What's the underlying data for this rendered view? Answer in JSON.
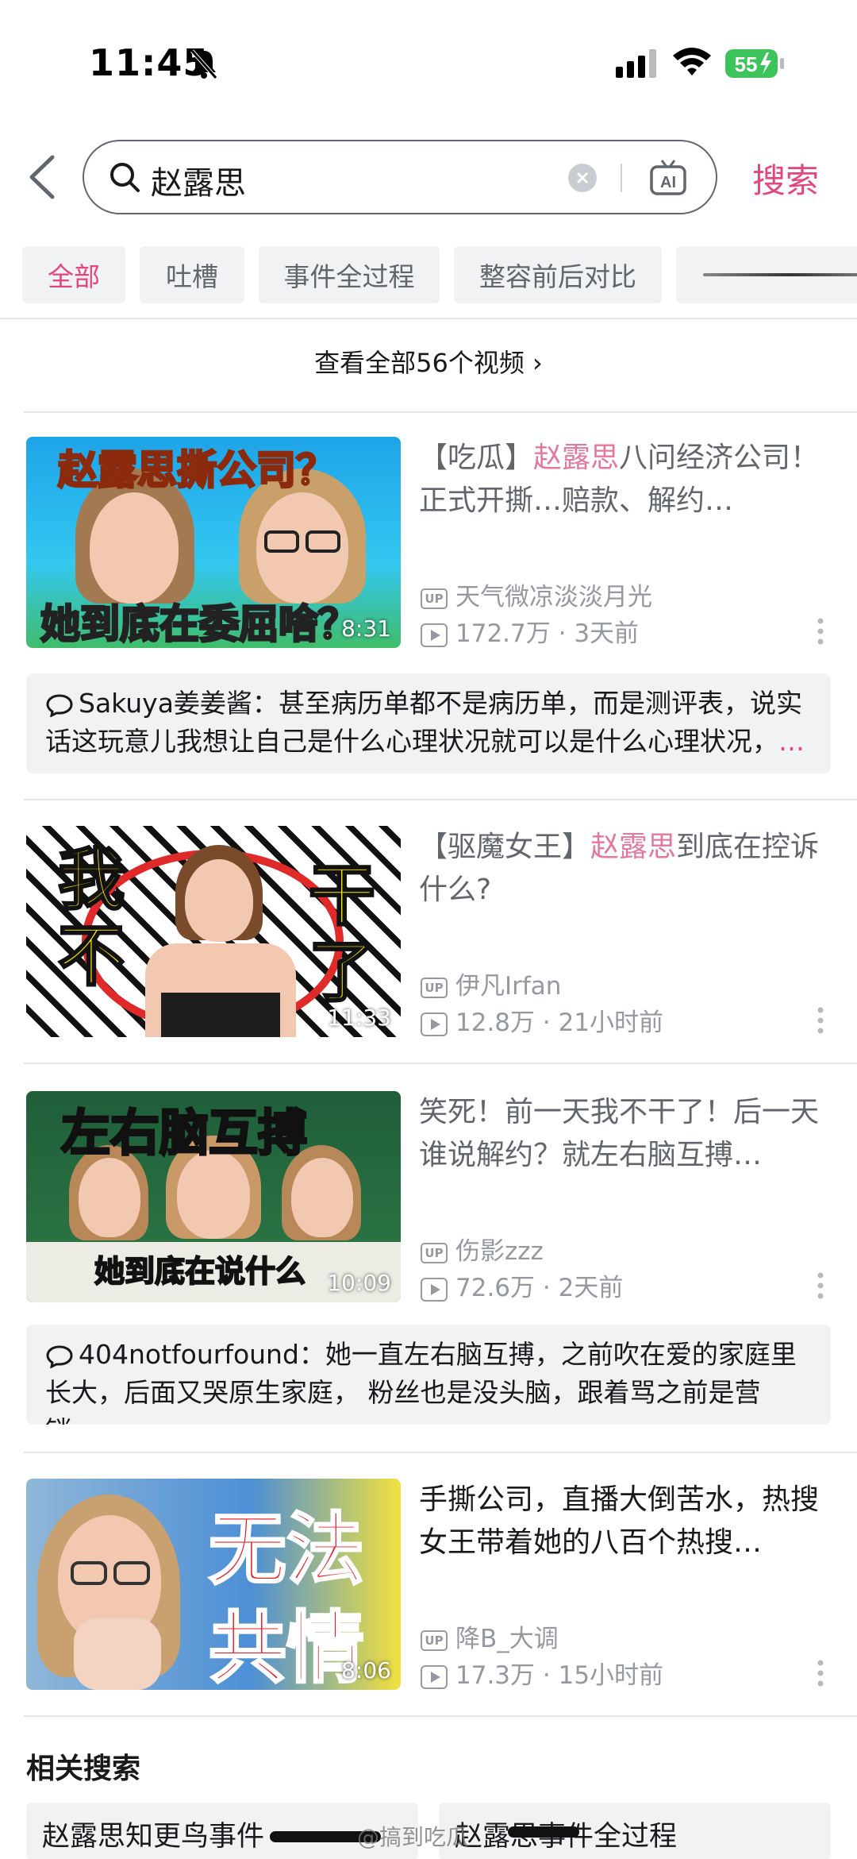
{
  "status_bar": {
    "time": "11:45",
    "battery": "55"
  },
  "search": {
    "query": "赵露思",
    "submit_label": "搜索",
    "ai_label": "AI"
  },
  "tabs": [
    "全部",
    "吐槽",
    "事件全过程",
    "整容前后对比"
  ],
  "view_all": "查看全部56个视频 ›",
  "videos": [
    {
      "title_prefix": "【吃瓜】",
      "title_highlight": "赵露思",
      "title_suffix": "八问经济公司！正式开撕…赔款、解约…",
      "uploader": "天气微凉淡淡月光",
      "views": "172.7万",
      "time": "3天前",
      "duration": "8:31",
      "thumb_text_top": "赵露思撕公司？",
      "thumb_text_bottom": "她到底在委屈啥？",
      "comment_user": "Sakuya姜姜酱：",
      "comment_text": "甚至病历单都不是病历单，而是测评表，说实话这玩意儿我想让自己是什么心理状况就可以是什么心理状况，",
      "comment_more": "…"
    },
    {
      "title_prefix": "【驱魔女王】",
      "title_highlight": "赵露思",
      "title_suffix": "到底在控诉什么?",
      "uploader": "伊凡Irfan",
      "views": "12.8万",
      "time": "21小时前",
      "duration": "11:33",
      "thumb_text_left": "我不",
      "thumb_text_right": "干了"
    },
    {
      "title_plain": "笑死！前一天我不干了！后一天谁说解约？就左右脑互搏…",
      "uploader": "伤影zzz",
      "views": "72.6万",
      "time": "2天前",
      "duration": "10:09",
      "thumb_text_top": "左右脑互搏",
      "thumb_text_bottom": "她到底在说什么",
      "comment_user": "404notfourfound：",
      "comment_text": "她一直左右脑互搏，之前吹在爱的家庭里长大，后面又哭原生家庭， 粉丝也是没头脑，跟着骂之前是营销…"
    },
    {
      "title_plain": "手撕公司，直播大倒苦水，热搜女王带着她的八百个热搜…",
      "uploader": "降B_大调",
      "views": "17.3万",
      "time": "15小时前",
      "duration": "8:06",
      "thumb_text_top": "无法",
      "thumb_text_bottom": "共情"
    }
  ],
  "related": {
    "title": "相关搜索",
    "items": [
      "赵露思知更鸟事件",
      "赵露思事件全过程"
    ]
  },
  "watermark": "@搞到吃瓜"
}
